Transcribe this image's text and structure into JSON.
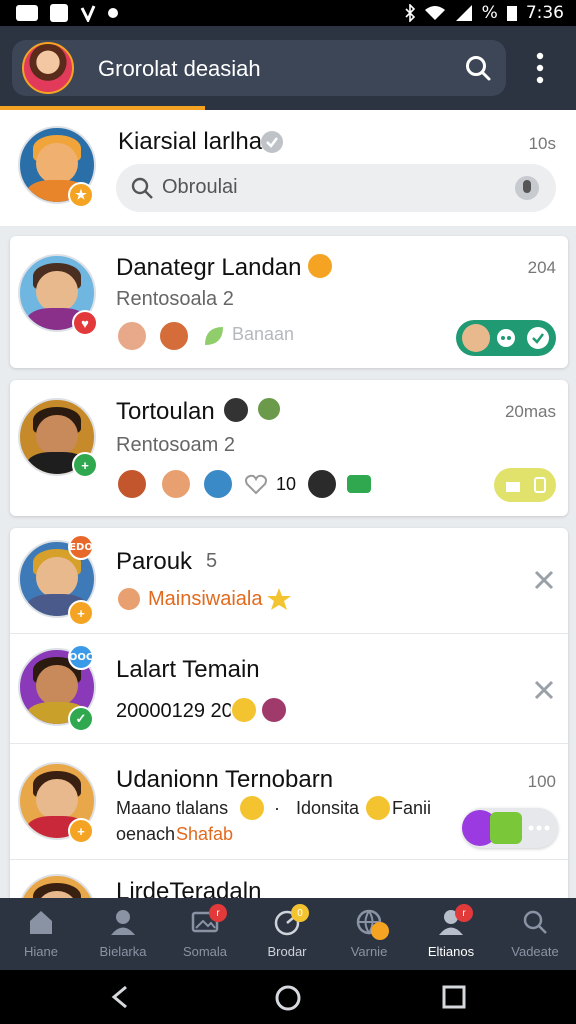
{
  "status_bar": {
    "time": "7:36",
    "battery": "%"
  },
  "app_bar": {
    "title": "Grorolat deasiah"
  },
  "top_row": {
    "name": "Kiarsial larlha",
    "time": "10s",
    "search_placeholder": "Obroulai"
  },
  "cards": [
    {
      "name": "Danategr Landan",
      "subtitle": "Rentosoala 2",
      "time": "204",
      "extra_label": "Banaan"
    },
    {
      "name": "Tortoulan",
      "subtitle": "Rentosoam 2",
      "time": "20mas",
      "count": "10"
    }
  ],
  "list": [
    {
      "name": "Parouk",
      "name_suffix": "5",
      "subtitle": "Mainsiwaiala",
      "top_badge": "EDO"
    },
    {
      "name": "Lalart Temain",
      "subtitle": "20000129 20",
      "top_badge": "OOC"
    },
    {
      "name": "Udanionn Ternobarn",
      "line1_a": "Maano tlalans",
      "line1_sep": "·",
      "line1_b": "Idonsita",
      "line1_c": "Fanii",
      "line2_a": "oenach",
      "line2_b": "Shafab",
      "time": "100"
    },
    {
      "name": "LirdeTeradaln"
    }
  ],
  "bottom_nav": {
    "items": [
      {
        "label": "Hiane",
        "icon": "home-icon"
      },
      {
        "label": "Bielarka",
        "icon": "person-icon"
      },
      {
        "label": "Somala",
        "icon": "image-icon"
      },
      {
        "label": "Brodar",
        "icon": "timer-icon"
      },
      {
        "label": "Varnie",
        "icon": "globe-icon"
      },
      {
        "label": "Eltianos",
        "icon": "people-icon"
      },
      {
        "label": "Vadeate",
        "icon": "search-icon"
      }
    ],
    "active_index": 5
  },
  "colors": {
    "app_bar": "#2c3441",
    "accent": "#f4a422",
    "green": "#1f9a72",
    "danger": "#e23a3a"
  }
}
